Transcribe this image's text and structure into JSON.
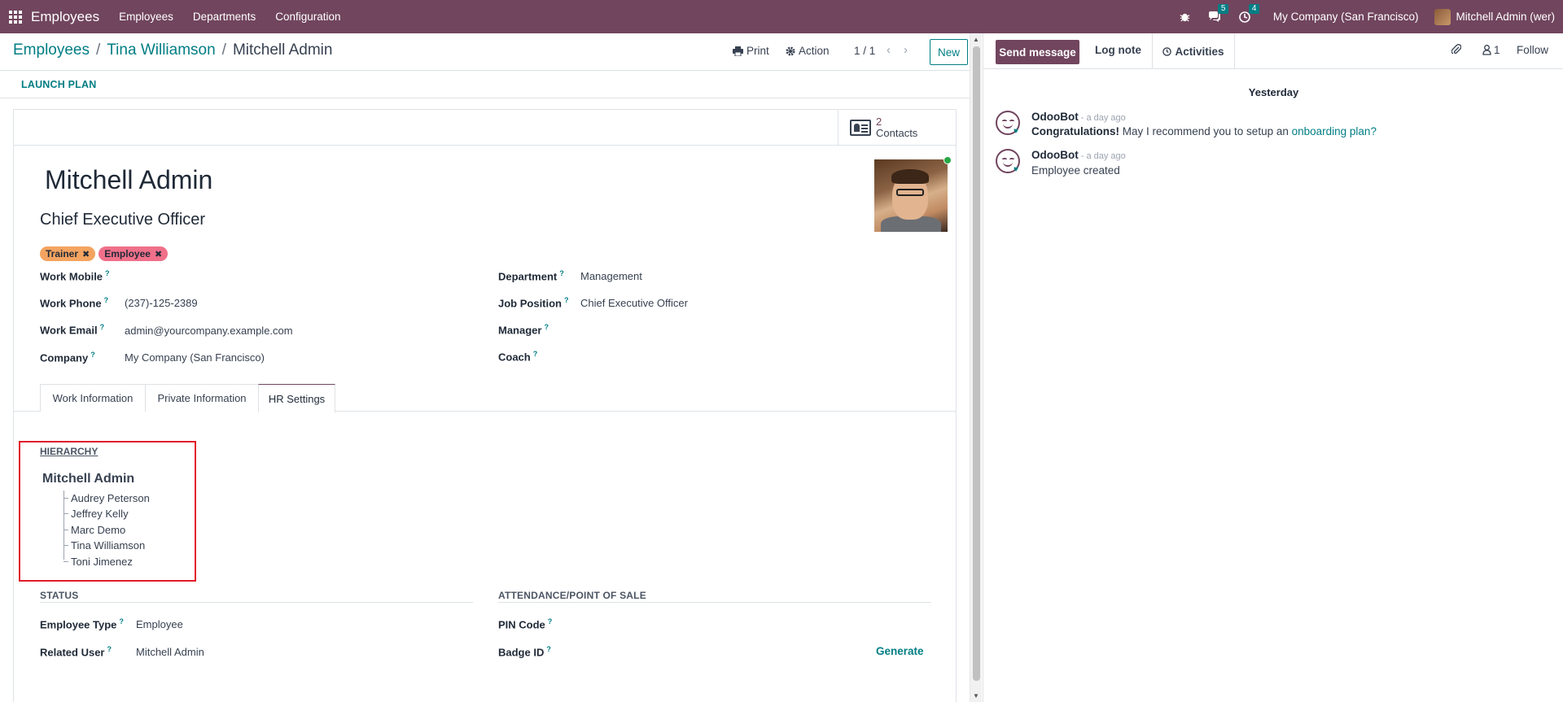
{
  "navbar": {
    "brand": "Employees",
    "menu": [
      "Employees",
      "Departments",
      "Configuration"
    ],
    "messages_count": "5",
    "activities_count": "4",
    "company": "My Company (San Francisco)",
    "user": "Mitchell Admin (wer)"
  },
  "breadcrumb": {
    "root": "Employees",
    "parent": "Tina Williamson",
    "current": "Mitchell Admin"
  },
  "toolbar": {
    "print": "Print",
    "action": "Action",
    "pager": "1 / 1",
    "new": "New",
    "launch_plan": "LAUNCH PLAN"
  },
  "smart_button": {
    "count": "2",
    "label": "Contacts"
  },
  "employee": {
    "name": "Mitchell Admin",
    "job_title": "Chief Executive Officer",
    "tags": [
      {
        "label": "Trainer",
        "color": "#f4a460"
      },
      {
        "label": "Employee",
        "color": "#f0708a"
      }
    ]
  },
  "fields": {
    "work_mobile_label": "Work Mobile",
    "work_mobile": "",
    "work_phone_label": "Work Phone",
    "work_phone": "(237)-125-2389",
    "work_email_label": "Work Email",
    "work_email": "admin@yourcompany.example.com",
    "company_label": "Company",
    "company": "My Company (San Francisco)",
    "department_label": "Department",
    "department": "Management",
    "job_position_label": "Job Position",
    "job_position": "Chief Executive Officer",
    "manager_label": "Manager",
    "manager": "",
    "coach_label": "Coach",
    "coach": ""
  },
  "tabs": [
    "Work Information",
    "Private Information",
    "HR Settings"
  ],
  "hierarchy": {
    "title": "HIERARCHY",
    "root": "Mitchell Admin",
    "children": [
      "Audrey Peterson",
      "Jeffrey Kelly",
      "Marc Demo",
      "Tina Williamson",
      "Toni Jimenez"
    ]
  },
  "status": {
    "title": "STATUS",
    "employee_type_label": "Employee Type",
    "employee_type": "Employee",
    "related_user_label": "Related User",
    "related_user": "Mitchell Admin"
  },
  "attendance": {
    "title": "ATTENDANCE/POINT OF SALE",
    "pin_code_label": "PIN Code",
    "badge_id_label": "Badge ID",
    "generate": "Generate"
  },
  "chatter": {
    "send_message": "Send message",
    "log_note": "Log note",
    "activities": "Activities",
    "followers_count": "1",
    "follow": "Follow",
    "day": "Yesterday",
    "messages": [
      {
        "author": "OdooBot",
        "time": "- a day ago",
        "bold": "Congratulations!",
        "text": " May I recommend you to setup an ",
        "link": "onboarding plan?"
      },
      {
        "author": "OdooBot",
        "time": "- a day ago",
        "text": "Employee created"
      }
    ]
  },
  "colors": {
    "brand": "#71455e",
    "accent": "#017e84"
  }
}
